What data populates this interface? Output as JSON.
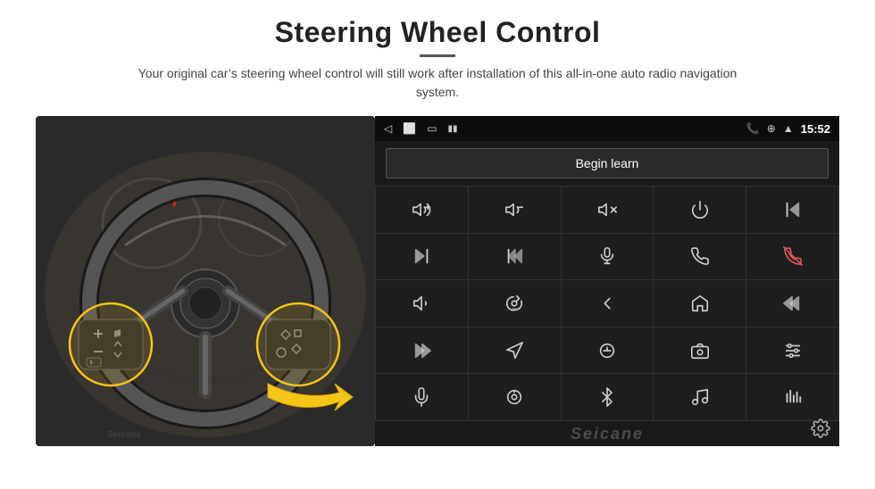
{
  "header": {
    "title": "Steering Wheel Control",
    "subtitle": "Your original car’s steering wheel control will still work after installation of this all-in-one auto radio navigation system."
  },
  "status_bar": {
    "time": "15:52",
    "icons": {
      "back": "◁",
      "home": "□",
      "recent": "□",
      "signal": "♥",
      "battery": "♥",
      "phone": "☎",
      "location": "⌕",
      "wifi": "▲"
    }
  },
  "begin_learn_btn": "Begin learn",
  "icon_grid": [
    {
      "name": "vol-up",
      "row": 1,
      "col": 1
    },
    {
      "name": "vol-down",
      "row": 1,
      "col": 2
    },
    {
      "name": "vol-mute",
      "row": 1,
      "col": 3
    },
    {
      "name": "power",
      "row": 1,
      "col": 4
    },
    {
      "name": "prev-track",
      "row": 1,
      "col": 5
    },
    {
      "name": "next-track",
      "row": 2,
      "col": 1
    },
    {
      "name": "fast-forward",
      "row": 2,
      "col": 2
    },
    {
      "name": "mic",
      "row": 2,
      "col": 3
    },
    {
      "name": "phone-call",
      "row": 2,
      "col": 4
    },
    {
      "name": "hang-up",
      "row": 2,
      "col": 5
    },
    {
      "name": "horn",
      "row": 3,
      "col": 1
    },
    {
      "name": "360-cam",
      "row": 3,
      "col": 2
    },
    {
      "name": "back-nav",
      "row": 3,
      "col": 3
    },
    {
      "name": "home-nav",
      "row": 3,
      "col": 4
    },
    {
      "name": "skip-back",
      "row": 3,
      "col": 5
    },
    {
      "name": "skip-fwd",
      "row": 4,
      "col": 1
    },
    {
      "name": "navigation",
      "row": 4,
      "col": 2
    },
    {
      "name": "eject",
      "row": 4,
      "col": 3
    },
    {
      "name": "camera",
      "row": 4,
      "col": 4
    },
    {
      "name": "eq-settings",
      "row": 4,
      "col": 5
    },
    {
      "name": "mic2",
      "row": 5,
      "col": 1
    },
    {
      "name": "knob",
      "row": 5,
      "col": 2
    },
    {
      "name": "bluetooth",
      "row": 5,
      "col": 3
    },
    {
      "name": "music",
      "row": 5,
      "col": 4
    },
    {
      "name": "eq-bars",
      "row": 5,
      "col": 5
    }
  ],
  "watermark": "Seicane",
  "colors": {
    "bg": "#ffffff",
    "android_bg": "#1a1a1a",
    "icon_color": "#cccccc",
    "accent_yellow": "#f5c518"
  }
}
